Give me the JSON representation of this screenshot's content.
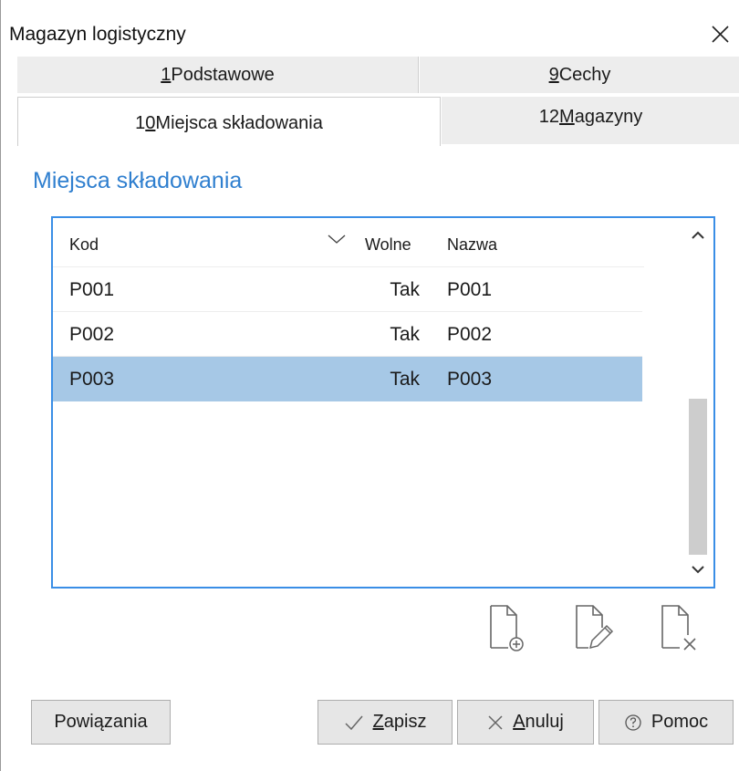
{
  "window": {
    "title": "Magazyn logistyczny"
  },
  "tabs": [
    {
      "prefix": "1",
      "rest": " Podstawowe"
    },
    {
      "prefix": "9",
      "rest": " Cechy"
    },
    {
      "before": "1",
      "accel": "0",
      "rest": " Miejsca składowania"
    },
    {
      "before": "12 ",
      "accel": "M",
      "rest": "agazyny"
    }
  ],
  "section": {
    "title": "Miejsca składowania"
  },
  "grid": {
    "columns": {
      "kod": "Kod",
      "wolne": "Wolne",
      "nazwa": "Nazwa"
    },
    "rows": [
      {
        "kod": "P001",
        "wolne": "Tak",
        "nazwa": "P001"
      },
      {
        "kod": "P002",
        "wolne": "Tak",
        "nazwa": "P002"
      },
      {
        "kod": "P003",
        "wolne": "Tak",
        "nazwa": "P003"
      }
    ],
    "selected_row": 2
  },
  "buttons": {
    "powiazania": "Powiązania",
    "zapisz": {
      "accel": "Z",
      "rest": "apisz"
    },
    "anuluj": {
      "accel": "A",
      "rest": "nuluj"
    },
    "pomoc": "Pomoc"
  },
  "icons": {
    "close": "close-icon",
    "sort": "chevron-down-icon",
    "add": "document-add-icon",
    "edit": "document-edit-icon",
    "delete": "document-delete-icon",
    "check": "check-icon",
    "cancel": "x-icon",
    "help": "question-circle-icon"
  },
  "colors": {
    "accent": "#2f7fcf",
    "selection": "#a6c8e6",
    "grid_border": "#3a8ee6"
  }
}
